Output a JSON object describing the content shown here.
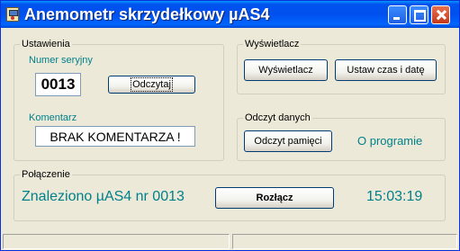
{
  "window": {
    "title": "Anemometr skrzydełkowy µAS4"
  },
  "settings": {
    "legend": "Ustawienia",
    "serial_label": "Numer seryjny",
    "serial_value": "0013",
    "read_button": "Odczytaj",
    "comment_label": "Komentarz",
    "comment_value": "BRAK KOMENTARZA !"
  },
  "display": {
    "legend": "Wyświetlacz",
    "display_button": "Wyświetlacz",
    "set_time_button": "Ustaw czas i datę"
  },
  "data_read": {
    "legend": "Odczyt danych",
    "memory_button": "Odczyt pamięci",
    "about_label": "O programie"
  },
  "connection": {
    "legend": "Połączenie",
    "status": "Znaleziono µAS4 nr 0013",
    "disconnect_button": "Rozłącz",
    "time": "15:03:19"
  },
  "colors": {
    "accent_teal": "#00808a",
    "titlebar_blue": "#0050ee",
    "background": "#ece9d8"
  }
}
